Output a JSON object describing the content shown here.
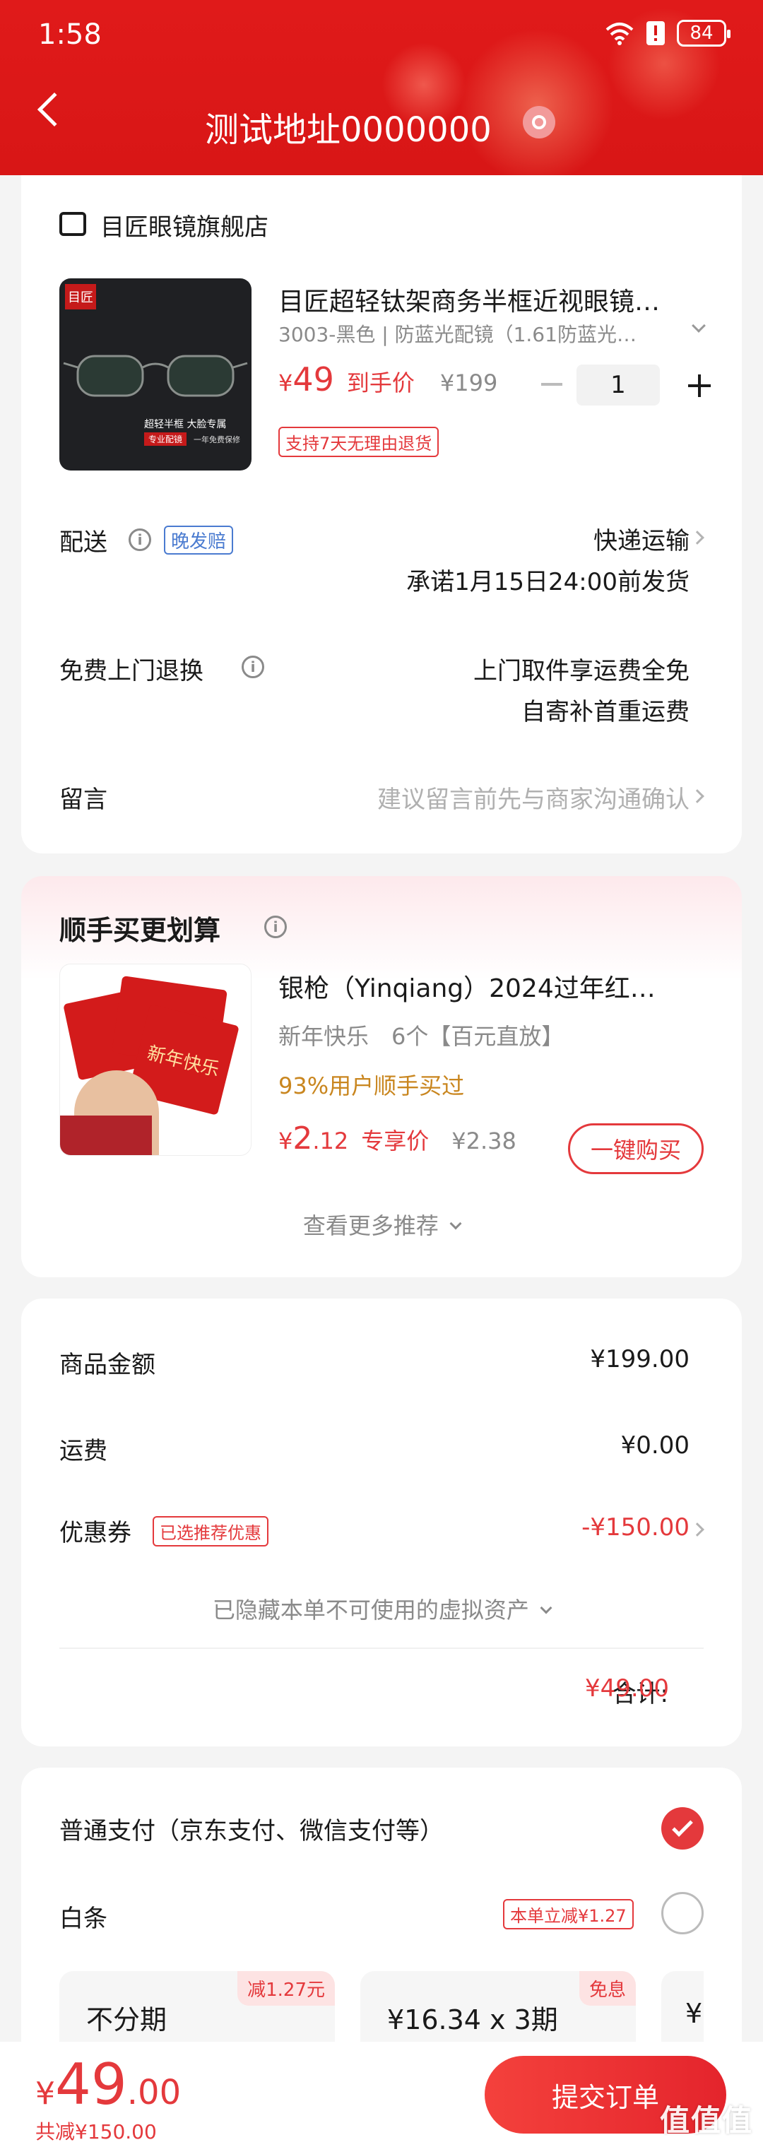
{
  "status": {
    "time": "1:58",
    "battery": "84"
  },
  "header": {
    "title": "测试地址0000000"
  },
  "store": {
    "name": "目匠眼镜旗舰店"
  },
  "product": {
    "title": "目匠超轻钛架商务半框近视眼镜…",
    "spec": "3003-黑色 | 防蓝光配镜（1.61防蓝光…",
    "price_symbol": "¥",
    "price": "49",
    "price_label": "到手价",
    "original_price": "¥199",
    "quantity": "1",
    "return_badge": "支持7天无理由退货",
    "image_text_1": "目匠",
    "image_text_2": "超轻半框 大脸专属",
    "image_text_3": "专业配镜",
    "image_text_4": "一年免费保修"
  },
  "delivery": {
    "label": "配送",
    "tag": "晚发赔",
    "method": "快递运输",
    "promise": "承诺1月15日24:00前发货"
  },
  "returns": {
    "label": "免费上门退换",
    "line1": "上门取件享运费全免",
    "line2": "自寄补首重运费"
  },
  "message": {
    "label": "留言",
    "placeholder": "建议留言前先与商家沟通确认"
  },
  "recommend": {
    "title": "顺手买更划算",
    "item_title": "银枪（Yinqiang）2024过年红…",
    "item_spec": "新年快乐　6个【百元直放】",
    "item_social": "93%用户顺手买过",
    "price_symbol": "¥",
    "price_int": "2",
    "price_dec": ".12",
    "price_label": "专享价",
    "original_price": "¥2.38",
    "buy_button": "一键购买",
    "more": "查看更多推荐",
    "envelope_text": "新年快乐"
  },
  "summary": {
    "goods_label": "商品金额",
    "goods_value": "¥199.00",
    "shipping_label": "运费",
    "shipping_value": "¥0.00",
    "coupon_label": "优惠券",
    "coupon_tag": "已选推荐优惠",
    "coupon_value": "-¥150.00",
    "hidden_assets": "已隐藏本单不可使用的虚拟资产",
    "total_label": "合计:",
    "total_value": "¥49.00"
  },
  "payment": {
    "normal_label": "普通支付（京东支付、微信支付等）",
    "baitiao_label": "白条",
    "baitiao_tag": "本单立减¥1.27",
    "plans": [
      {
        "tag": "减1.27元",
        "text": "不分期"
      },
      {
        "tag": "免息",
        "text": "¥16.34 x 3期"
      },
      {
        "tag": "",
        "text": "¥"
      }
    ]
  },
  "bottom": {
    "price_symbol": "¥",
    "price_int": "49",
    "price_dec": ".00",
    "saved": "共减¥150.00",
    "submit": "提交订单",
    "watermark": "值值值"
  },
  "colors": {
    "brand_red": "#e4393c",
    "header_red": "#d81616",
    "link_blue": "#4a7bd0"
  }
}
